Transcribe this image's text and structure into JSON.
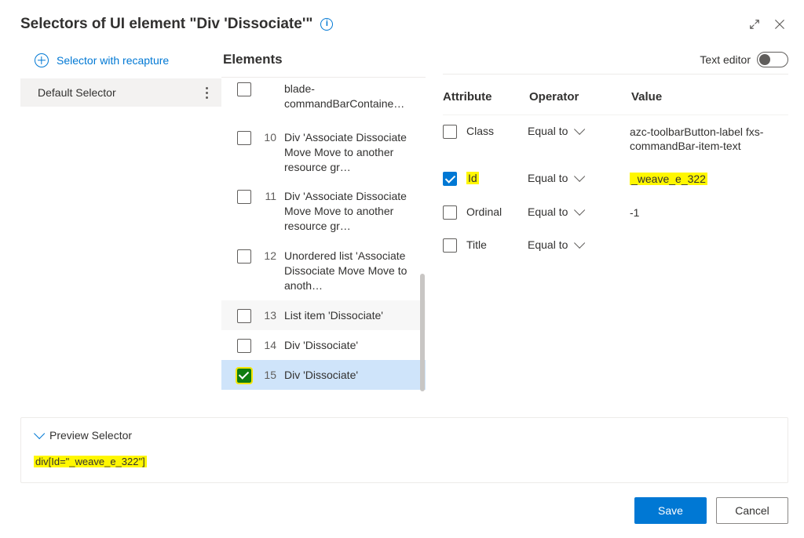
{
  "header": {
    "title": "Selectors of UI element \"Div 'Dissociate'\""
  },
  "left": {
    "add_label": "Selector with recapture",
    "selectors": [
      {
        "label": "Default Selector"
      }
    ]
  },
  "elements": {
    "heading": "Elements",
    "rows": [
      {
        "idx": "",
        "label": "blade-commandBarContaine…",
        "checked": false,
        "selected": false,
        "partial": true
      },
      {
        "idx": "10",
        "label": "Div 'Associate  Dissociate  Move  Move to another resource gr…",
        "checked": false,
        "selected": false
      },
      {
        "idx": "11",
        "label": "Div 'Associate  Dissociate  Move  Move to another resource gr…",
        "checked": false,
        "selected": false
      },
      {
        "idx": "12",
        "label": "Unordered list 'Associate  Dissociate  Move  Move to anoth…",
        "checked": false,
        "selected": false
      },
      {
        "idx": "13",
        "label": "List item 'Dissociate'",
        "checked": false,
        "selected": false
      },
      {
        "idx": "14",
        "label": "Div 'Dissociate'",
        "checked": false,
        "selected": false
      },
      {
        "idx": "15",
        "label": "Div 'Dissociate'",
        "checked": true,
        "selected": true
      }
    ]
  },
  "attributes": {
    "text_editor_label": "Text editor",
    "text_editor_on": false,
    "columns": {
      "attribute": "Attribute",
      "operator": "Operator",
      "value": "Value"
    },
    "rows": [
      {
        "name": "Class",
        "checked": false,
        "op": "Equal to",
        "value": "azc-toolbarButton-label fxs-commandBar-item-text",
        "highlight_name": false,
        "highlight_value": false
      },
      {
        "name": "Id",
        "checked": true,
        "op": "Equal to",
        "value": "_weave_e_322",
        "highlight_name": true,
        "highlight_value": true
      },
      {
        "name": "Ordinal",
        "checked": false,
        "op": "Equal to",
        "value": "-1",
        "highlight_name": false,
        "highlight_value": false
      },
      {
        "name": "Title",
        "checked": false,
        "op": "Equal to",
        "value": "",
        "highlight_name": false,
        "highlight_value": false
      }
    ]
  },
  "preview": {
    "toggle_label": "Preview Selector",
    "text": "div[Id=\"_weave_e_322\"]"
  },
  "footer": {
    "save": "Save",
    "cancel": "Cancel"
  }
}
